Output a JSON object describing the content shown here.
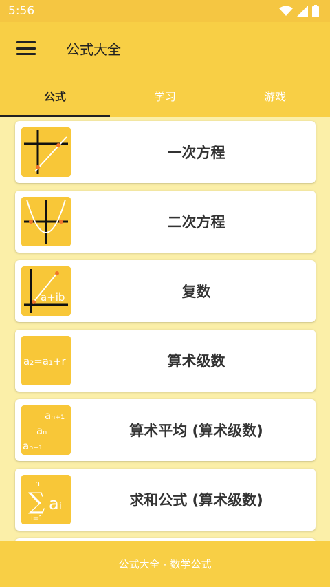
{
  "status_bar": {
    "time": "5:56"
  },
  "app_bar": {
    "title": "公式大全"
  },
  "tabs": [
    {
      "label": "公式"
    },
    {
      "label": "学习"
    },
    {
      "label": "游戏"
    }
  ],
  "items": [
    {
      "label": "一次方程"
    },
    {
      "label": "二次方程"
    },
    {
      "label": "复数",
      "thumb_text": "a+ib"
    },
    {
      "label": "算术级数",
      "thumb_text": "a₂=a₁+r"
    },
    {
      "label": "算术平均 (算术级数)",
      "thumb_text": [
        "aₙ₊₁",
        "aₙ",
        "aₙ₋₁"
      ]
    },
    {
      "label": "求和公式 (算术级数)",
      "thumb_text": {
        "top": "n",
        "bottom": "i=1",
        "term": "aᵢ"
      }
    }
  ],
  "footer": {
    "text": "公式大全 - 数学公式"
  },
  "colors": {
    "status_bar": "#F5C642",
    "app_bar": "#F8CF45",
    "background": "#FBEFA8",
    "thumb": "#F8C738",
    "accent_point": "#F0752A"
  }
}
